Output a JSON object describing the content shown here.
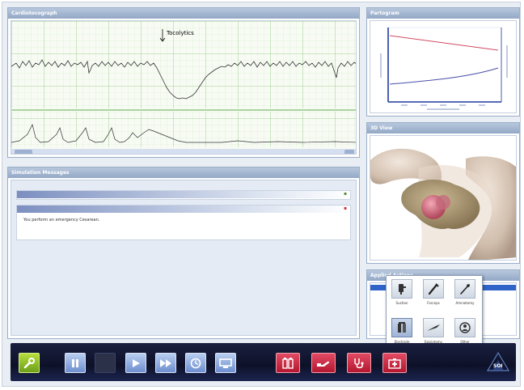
{
  "cardiotocograph": {
    "title": "Cardiotocograph",
    "annotation": "Tocolytics",
    "time_labels": [
      "",
      "",
      "",
      "",
      "",
      ""
    ]
  },
  "partogram": {
    "title": "Partogram",
    "x_ticks": [
      "",
      "",
      "",
      "",
      ""
    ]
  },
  "view3d": {
    "title": "3D View"
  },
  "messages": {
    "title": "Simulation Messages",
    "items": [
      {
        "header": "",
        "text": ""
      },
      {
        "header": "",
        "text": "You perform an emergency Cesarean."
      }
    ]
  },
  "applied": {
    "title": "Applied Actions"
  },
  "tools": [
    {
      "label": "Suction",
      "icon": "suction-icon"
    },
    {
      "label": "Forceps",
      "icon": "forceps-icon"
    },
    {
      "label": "Amniotomy",
      "icon": "amniotomy-icon"
    },
    {
      "label": "Electrode",
      "icon": "electrode-icon"
    },
    {
      "label": "Episiotomy",
      "icon": "scalpel-icon"
    },
    {
      "label": "Other",
      "icon": "other-icon"
    }
  ],
  "toolbar": {
    "buttons": [
      {
        "name": "settings-button",
        "icon": "wrench-icon",
        "color": "#8fc12a"
      },
      {
        "name": "pause-button",
        "icon": "pause-icon",
        "color": "#7f9fd8"
      },
      {
        "name": "play-button",
        "icon": "play-icon",
        "color": "#7f9fd8"
      },
      {
        "name": "fast-forward-button",
        "icon": "fast-forward-icon",
        "color": "#7f9fd8"
      },
      {
        "name": "clock-button",
        "icon": "clock-icon",
        "color": "#7f9fd8"
      },
      {
        "name": "monitor-button",
        "icon": "monitor-icon",
        "color": "#7f9fd8"
      },
      {
        "name": "medication-button",
        "icon": "medication-icon",
        "color": "#d22a45"
      },
      {
        "name": "hand-button",
        "icon": "hand-icon",
        "color": "#d22a45"
      },
      {
        "name": "stethoscope-button",
        "icon": "stethoscope-icon",
        "color": "#d22a45"
      },
      {
        "name": "first-aid-button",
        "icon": "first-aid-icon",
        "color": "#d22a45"
      }
    ],
    "logo": "SOI"
  }
}
